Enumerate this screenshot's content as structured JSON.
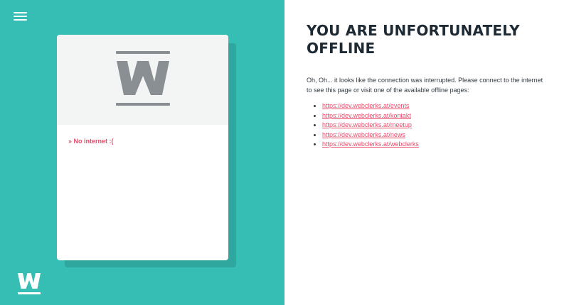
{
  "menu": {
    "icon": "hamburger-menu-icon"
  },
  "card": {
    "logo": {
      "icon": "webclerks-w-logo-icon",
      "letter": "W",
      "color": "#8a8f93"
    },
    "message": "» No internet :("
  },
  "footer": {
    "logo": {
      "icon": "webclerks-w-logo-icon",
      "letter": "W"
    }
  },
  "content": {
    "title": "YOU ARE UNFORTUNATELY OFFLINE",
    "description": "Oh, Oh... it looks like the connection was interrupted. Please connect to the internet to see this page or visit one of the available offline pages:",
    "links": [
      "https://dev.webclerks.at/events",
      "https://dev.webclerks.at/kontakt",
      "https://dev.webclerks.at/meetup",
      "https://dev.webclerks.at/news",
      "https://dev.webclerks.at/webclerks"
    ]
  },
  "colors": {
    "teal": "#36bdb4",
    "accent": "#e84a6a",
    "heading": "#1e2a33"
  }
}
